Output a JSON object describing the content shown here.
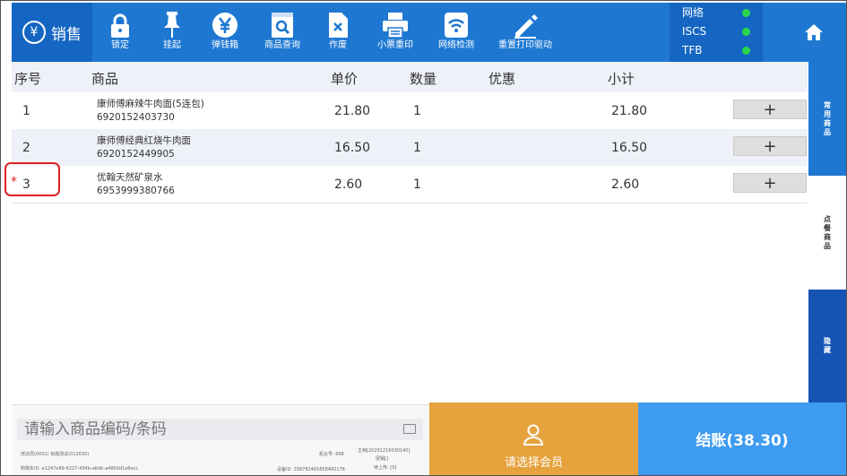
{
  "brand": {
    "icon": "yen-circle-icon",
    "label": "销售"
  },
  "toolbar": [
    {
      "name": "lock",
      "icon": "lock-icon",
      "label": "锁定"
    },
    {
      "name": "suspend",
      "icon": "pin-icon",
      "label": "挂起"
    },
    {
      "name": "cash-drawer",
      "icon": "yen-coin-icon",
      "label": "弹钱箱"
    },
    {
      "name": "product-query",
      "icon": "search-doc-icon",
      "label": "商品查询"
    },
    {
      "name": "void",
      "icon": "void-doc-icon",
      "label": "作废"
    },
    {
      "name": "reprint",
      "icon": "printer-icon",
      "label": "小票重印"
    },
    {
      "name": "network-check",
      "icon": "wifi-icon",
      "label": "网络检测"
    },
    {
      "name": "reset-printer",
      "icon": "pencil-icon",
      "label": "重置打印驱动"
    }
  ],
  "status": [
    {
      "label": "网络",
      "state_color": "#2ad64a"
    },
    {
      "label": "ISCS",
      "state_color": "#2ad64a"
    },
    {
      "label": "TFB",
      "state_color": "#2ad64a"
    }
  ],
  "home": {
    "icon": "home-icon"
  },
  "table": {
    "headers": {
      "index": "序号",
      "product": "商品",
      "price": "单价",
      "qty": "数量",
      "discount": "优惠",
      "subtotal": "小计"
    },
    "rows": [
      {
        "index": "1",
        "name": "康师傅麻辣牛肉面(5连包)",
        "code": "6920152403730",
        "price": "21.80",
        "qty": "1",
        "discount": "",
        "subtotal": "21.80",
        "plus": "+"
      },
      {
        "index": "2",
        "name": "康师傅经典红烧牛肉面",
        "code": "6920152449905",
        "price": "16.50",
        "qty": "1",
        "discount": "",
        "subtotal": "16.50",
        "plus": "+"
      },
      {
        "index": "3",
        "name": "优翰天然矿泉水",
        "code": "6953999380766",
        "price": "2.60",
        "qty": "1",
        "discount": "",
        "subtotal": "2.60",
        "plus": "+"
      }
    ],
    "selected_marker": "*"
  },
  "side_tabs": [
    {
      "label": "常用商品"
    },
    {
      "label": "点餐商品"
    },
    {
      "label": "隐藏"
    }
  ],
  "search": {
    "placeholder": "请输入商品编码/条码"
  },
  "footer_info": {
    "trainer": "培训员(0001) 标题测试(012630)",
    "terminal_id": "购物车ID: e1247e89-6227-494b-a6db-a4800d1e6ecc",
    "machine_no": "机台号: 668",
    "main_file": "主档[20201216030140]",
    "promo": "促销[]",
    "device_id": "设备ID: 338782465858482176",
    "pending_upload": "待上传: [0]"
  },
  "member": {
    "icon": "person-icon",
    "label": "请选择会员"
  },
  "checkout": {
    "label": "结账(38.30)"
  },
  "colors": {
    "topbar": "#1e78d2",
    "brand_bg": "#1466c2",
    "member": "#e6a23d",
    "checkout": "#3d9bf0",
    "status_ok": "#2ad64a",
    "highlight": "#e02020"
  }
}
